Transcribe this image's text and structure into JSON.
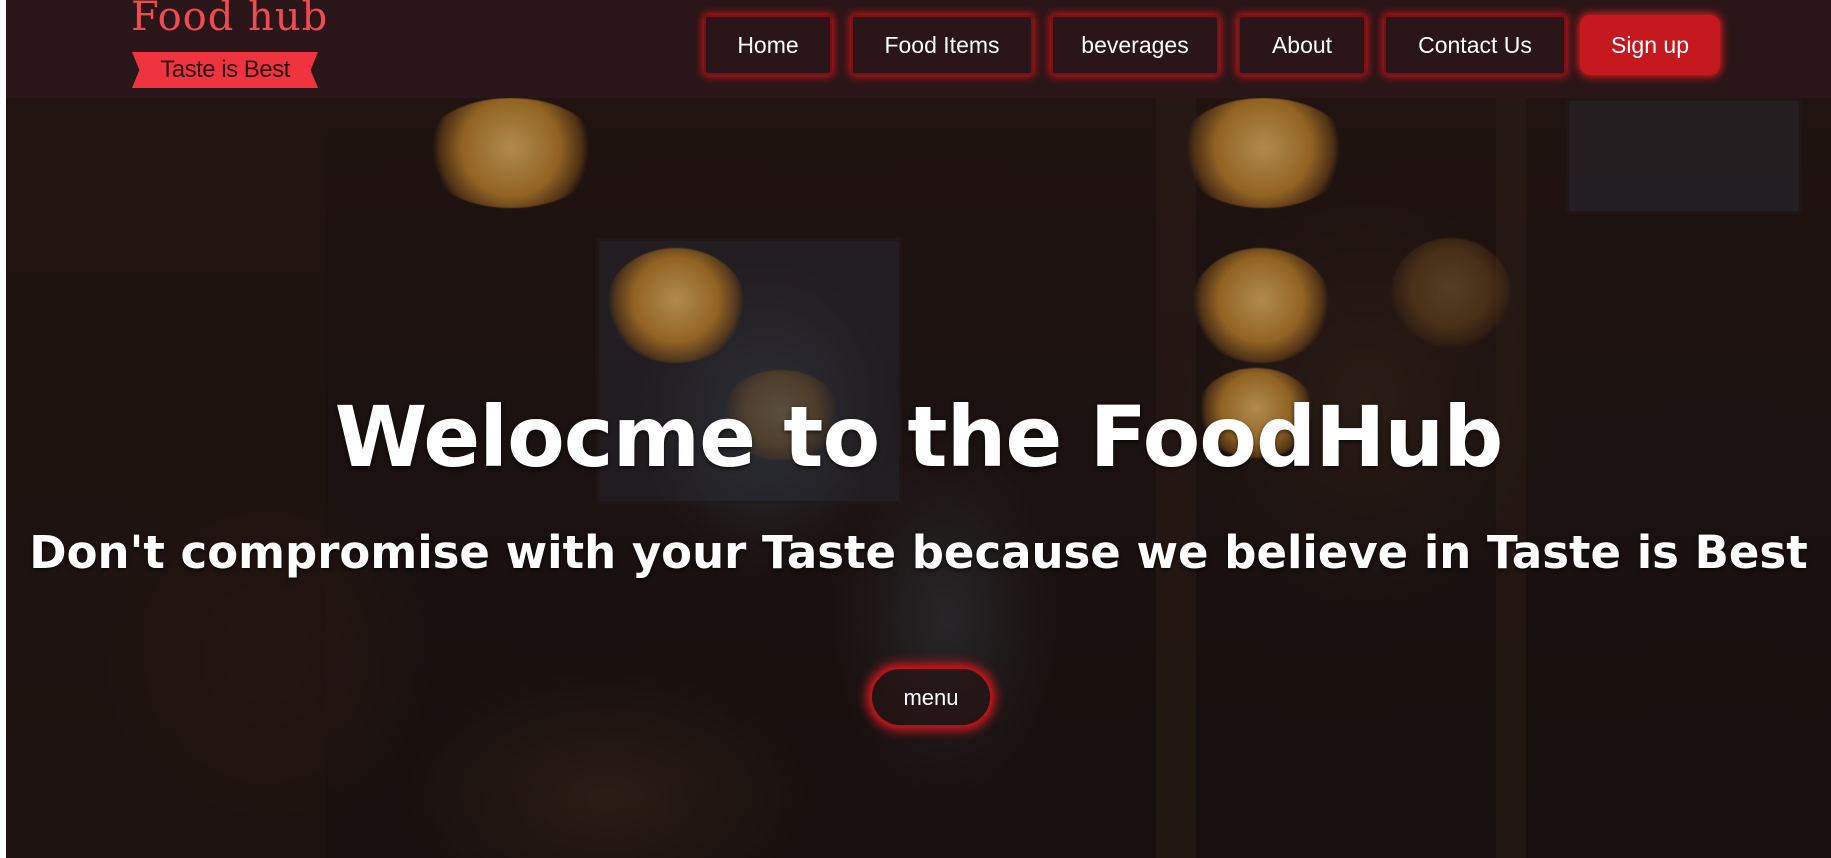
{
  "brand": {
    "title": "Food hub",
    "tagline": "Taste is Best",
    "color": "#f24a52",
    "ribbon_color": "#f0343f"
  },
  "nav": {
    "items": [
      {
        "label": "Home"
      },
      {
        "label": "Food Items"
      },
      {
        "label": "beverages"
      },
      {
        "label": "About"
      },
      {
        "label": "Contact Us"
      }
    ],
    "signup_label": "Sign up",
    "accent": "#c6191f"
  },
  "hero": {
    "title": "Welocme to the FoodHub",
    "subtitle": "Don't compromise with your Taste because we believe in Taste is Best",
    "menu_label": "menu"
  }
}
